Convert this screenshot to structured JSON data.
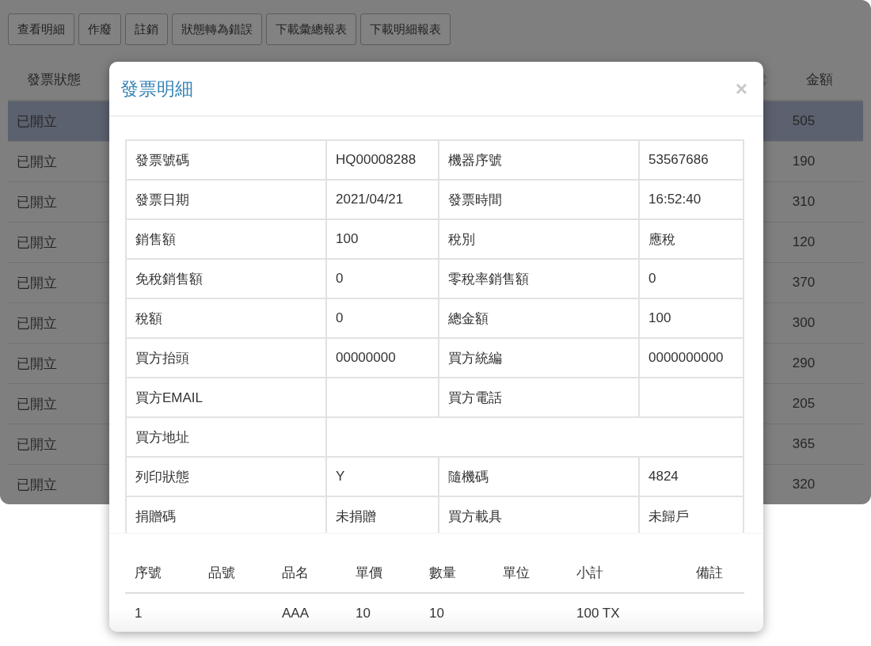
{
  "toolbar": {
    "buttons": [
      "查看明細",
      "作廢",
      "註銷",
      "狀態轉為錯誤",
      "下載彙總報表",
      "下載明細報表"
    ]
  },
  "table": {
    "columns": [
      {
        "label": "發票狀態",
        "sortable": false
      },
      {
        "label": "金額",
        "sortable": true
      }
    ],
    "rows": [
      {
        "status": "已開立",
        "amount": "505",
        "selected": true
      },
      {
        "status": "已開立",
        "amount": "190",
        "selected": false
      },
      {
        "status": "已開立",
        "amount": "310",
        "selected": false
      },
      {
        "status": "已開立",
        "amount": "120",
        "selected": false
      },
      {
        "status": "已開立",
        "amount": "370",
        "selected": false
      },
      {
        "status": "已開立",
        "amount": "300",
        "selected": false
      },
      {
        "status": "已開立",
        "amount": "290",
        "selected": false
      },
      {
        "status": "已開立",
        "amount": "205",
        "selected": false
      },
      {
        "status": "已開立",
        "amount": "365",
        "selected": false
      },
      {
        "status": "已開立",
        "amount": "320",
        "selected": false
      }
    ]
  },
  "modal": {
    "title": "發票明細",
    "close": "×",
    "details": [
      [
        {
          "label": "發票號碼",
          "value": "HQ00008288"
        },
        {
          "label": "機器序號",
          "value": "53567686"
        }
      ],
      [
        {
          "label": "發票日期",
          "value": "2021/04/21"
        },
        {
          "label": "發票時間",
          "value": "16:52:40"
        }
      ],
      [
        {
          "label": "銷售額",
          "value": "100"
        },
        {
          "label": "稅別",
          "value": "應稅"
        }
      ],
      [
        {
          "label": "免稅銷售額",
          "value": "0"
        },
        {
          "label": "零稅率銷售額",
          "value": "0"
        }
      ],
      [
        {
          "label": "稅額",
          "value": "0"
        },
        {
          "label": "總金額",
          "value": "100"
        }
      ],
      [
        {
          "label": "買方抬頭",
          "value": "00000000"
        },
        {
          "label": "買方統編",
          "value": "0000000000"
        }
      ],
      [
        {
          "label": "買方EMAIL"
        },
        {
          "label": "買方電話"
        }
      ],
      [
        {
          "label": "買方地址"
        }
      ],
      [
        {
          "label": "列印狀態",
          "value": "Y"
        },
        {
          "label": "隨機碼",
          "value": "4824"
        }
      ],
      [
        {
          "label": "捐贈碼",
          "value": "未捐贈"
        },
        {
          "label": "買方載具",
          "value": "未歸戶"
        }
      ]
    ],
    "items": {
      "columns": [
        "序號",
        "品號",
        "品名",
        "單價",
        "數量",
        "單位",
        "小計",
        "備註"
      ],
      "rows": [
        {
          "seq": "1",
          "product_name": "AAA",
          "unit_price": "10",
          "quantity": "10",
          "subtotal": "100 TX"
        }
      ]
    }
  }
}
